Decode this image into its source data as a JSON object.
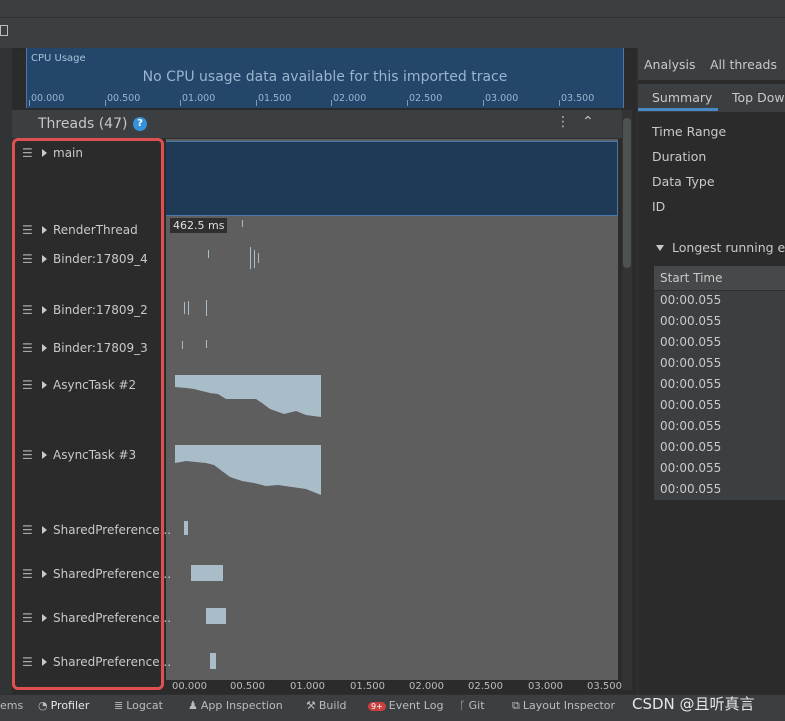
{
  "cpu_usage": {
    "title": "CPU Usage",
    "message": "No CPU usage data available for this imported trace",
    "ticks": [
      "00.000",
      "00.500",
      "01.000",
      "01.500",
      "02.000",
      "02.500",
      "03.000",
      "03.500"
    ]
  },
  "threads": {
    "title": "Threads (47)",
    "help_icon": "?",
    "kebab_icon": "⋮",
    "collapse_icon": "⌃",
    "selection_duration": "462.5 ms",
    "items": [
      {
        "label": "main"
      },
      {
        "label": "RenderThread"
      },
      {
        "label": "Binder:17809_4"
      },
      {
        "label": "Binder:17809_2"
      },
      {
        "label": "Binder:17809_3"
      },
      {
        "label": "AsyncTask #2"
      },
      {
        "label": "AsyncTask #3"
      },
      {
        "label": "SharedPreference..."
      },
      {
        "label": "SharedPreference..."
      },
      {
        "label": "SharedPreference..."
      },
      {
        "label": "SharedPreference..."
      }
    ]
  },
  "time_axis": {
    "ticks": [
      "00.000",
      "00.500",
      "01.000",
      "01.500",
      "02.000",
      "02.500",
      "03.000",
      "03.500"
    ]
  },
  "analysis_panel": {
    "tabs": [
      "Analysis",
      "All threads"
    ],
    "subtabs": [
      "Summary",
      "Top Dow"
    ],
    "properties": [
      "Time Range",
      "Duration",
      "Data Type",
      "ID"
    ],
    "longest_label": "Longest running eve",
    "table_header": "Start Time",
    "rows": [
      "00:00.055",
      "00:00.055",
      "00:00.055",
      "00:00.055",
      "00:00.055",
      "00:00.055",
      "00:00.055",
      "00:00.055",
      "00:00.055",
      "00:00.055"
    ]
  },
  "bottom_bar": {
    "items": [
      "ems",
      "Profiler",
      "Logcat",
      "App Inspection",
      "Build",
      "Event Log",
      "Git",
      "Layout Inspector"
    ],
    "badge": "9+"
  },
  "watermark": "CSDN @且听真言",
  "colors": {
    "accent": "#4a88c7",
    "highlight_box": "#e05050",
    "cpu_background": "#23466a",
    "track_fill": "#a9bdc9"
  }
}
